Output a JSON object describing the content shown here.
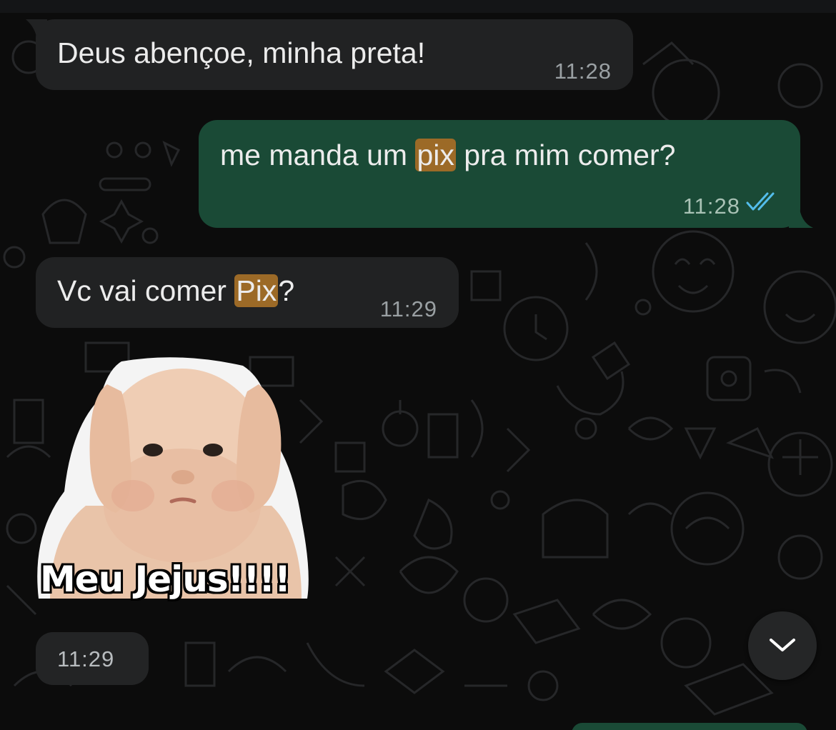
{
  "colors": {
    "background": "#0c0c0c",
    "incoming_bubble": "#212223",
    "outgoing_bubble": "#1a4a36",
    "search_highlight": "#9c6a27",
    "read_ticks": "#53bdeb"
  },
  "messages": [
    {
      "direction": "incoming",
      "text": "Deus abençoe, minha preta!",
      "time": "11:28"
    },
    {
      "direction": "outgoing",
      "text_before": "me manda um ",
      "highlight": "pix",
      "text_after": " pra mim comer?",
      "time": "11:28",
      "status_icon": "double-check-read-icon"
    },
    {
      "direction": "incoming",
      "text_before": "Vc vai comer ",
      "highlight": "Pix",
      "text_after": "?",
      "time": "11:29"
    },
    {
      "direction": "incoming",
      "type": "sticker",
      "sticker_caption": "Meu Jejus!!!!",
      "time": "11:29"
    }
  ],
  "scroll_button": {
    "icon": "chevron-down-icon"
  }
}
